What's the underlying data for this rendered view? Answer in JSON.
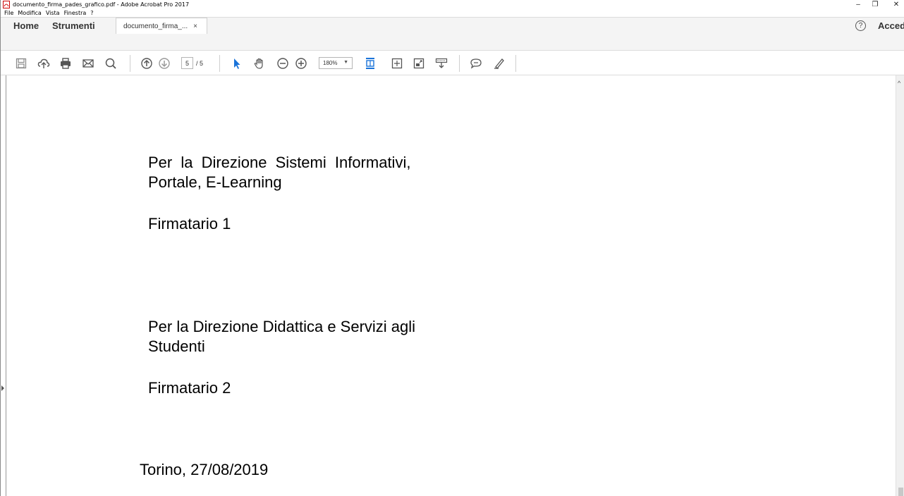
{
  "window": {
    "title": "documento_firma_pades_grafico.pdf - Adobe Acrobat Pro 2017",
    "controls": {
      "minimize": "–",
      "maximize": "❐",
      "close": "✕"
    }
  },
  "menu": [
    "File",
    "Modifica",
    "Vista",
    "Finestra",
    "?"
  ],
  "tabs": {
    "home": "Home",
    "tools": "Strumenti",
    "document": "documento_firma_...",
    "document_close": "×",
    "help": "?",
    "signin": "Accedi"
  },
  "toolbar": {
    "page_current": "5",
    "page_total": "/ 5",
    "zoom": "180%",
    "zoom_arrow": "▼",
    "icons": [
      "save-icon",
      "cloud-upload-icon",
      "print-icon",
      "email-icon",
      "search-icon",
      "page-up-icon",
      "page-down-icon",
      "select-arrow-icon",
      "hand-icon",
      "zoom-out-icon",
      "zoom-in-icon",
      "fit-page-icon",
      "fit-width-icon",
      "fullscreen-icon",
      "read-mode-icon",
      "comment-icon",
      "highlight-pen-icon"
    ]
  },
  "document": {
    "line1": "Per la Direzione Sistemi Informativi,",
    "line2": "Portale, E-Learning",
    "signer1": "Firmatario 1",
    "line3": "Per la Direzione Didattica e Servizi agli",
    "line4": "Studenti",
    "signer2": "Firmatario 2",
    "place_date": "Torino, 27/08/2019"
  },
  "scrollbar": {
    "up_arrow": "^"
  },
  "colors": {
    "accent_blue": "#1a73d9",
    "icon_gray": "#555555"
  }
}
